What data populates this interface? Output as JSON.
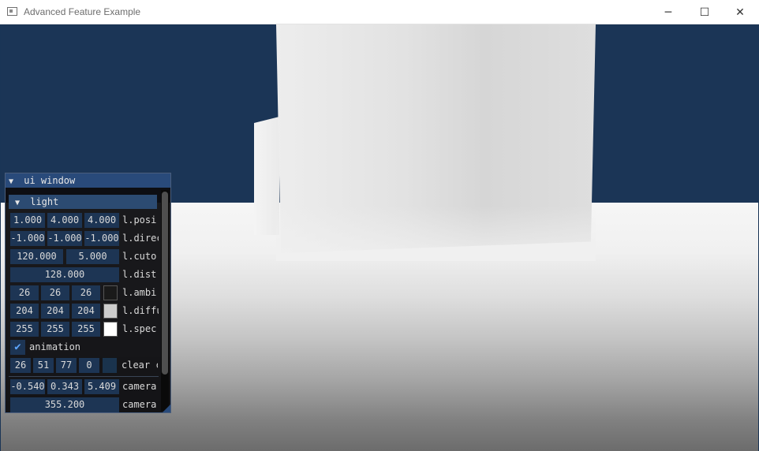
{
  "window": {
    "title": "Advanced Feature Example",
    "minimize_glyph": "─",
    "maximize_glyph": "☐",
    "close_glyph": "✕"
  },
  "scene": {
    "sky_color": "#1b3556",
    "floor_color": "#f0f0f0",
    "cube_color": "#e0e0e0"
  },
  "ui_window": {
    "title": "ui window",
    "collapse_glyph": "▼",
    "light_header": "light",
    "light_collapse_glyph": "▼",
    "position": {
      "values": [
        "1.000",
        "4.000",
        "4.000"
      ],
      "label": "l.posi"
    },
    "direction": {
      "values": [
        "-1.000",
        "-1.000",
        "-1.000"
      ],
      "label": "l.direc"
    },
    "cutoff": {
      "values": [
        "120.000",
        "5.000"
      ],
      "label": "l.cuto"
    },
    "distance": {
      "value": "128.000",
      "label": "l.dist"
    },
    "ambient": {
      "values": [
        "26",
        "26",
        "26"
      ],
      "label": "l.ambi",
      "swatch": "#1a1a1a"
    },
    "diffuse": {
      "values": [
        "204",
        "204",
        "204"
      ],
      "label": "l.diffu",
      "swatch": "#cccccc"
    },
    "specular": {
      "values": [
        "255",
        "255",
        "255"
      ],
      "label": "l.spec",
      "swatch": "#ffffff"
    },
    "animation": {
      "label": "animation",
      "checked": true,
      "check_glyph": "✔"
    },
    "clear_color": {
      "values": [
        "26",
        "51",
        "77",
        "0"
      ],
      "label": "clear c",
      "swatch": "#1a334d"
    },
    "camera_pos": {
      "values": [
        "-0.540",
        "0.343",
        "5.409"
      ],
      "label": "camera"
    },
    "camera_rot": {
      "value": "355.200",
      "label": "camera"
    }
  }
}
